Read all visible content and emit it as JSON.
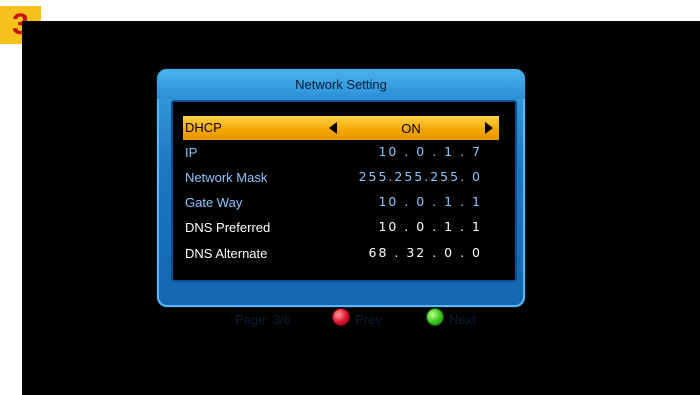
{
  "step_badge": "3",
  "dialog": {
    "title": "Network Setting",
    "rows": [
      {
        "label": "DHCP",
        "value": "ON"
      },
      {
        "label": "IP",
        "value": "10 . 0 . 1 . 7"
      },
      {
        "label": "Network Mask",
        "value": "255.255.255. 0"
      },
      {
        "label": "Gate Way",
        "value": "10 . 0 . 1 . 1"
      },
      {
        "label": "DNS Preferred",
        "value": "10 . 0 . 1 . 1"
      },
      {
        "label": "DNS Alternate",
        "value": "68 . 32 . 0 . 0"
      }
    ]
  },
  "footer": {
    "page": "Page: 3/6",
    "prev": "Prev",
    "next": "Next",
    "prev_button_color": "#e0102a",
    "next_button_color": "#35c21a"
  },
  "colors": {
    "highlight": "#f5a800",
    "dialog_blue": "#1e78c4",
    "label_blue": "#8cc4ff"
  },
  "icons": {
    "left": "arrow-left-icon",
    "right": "arrow-right-icon"
  }
}
